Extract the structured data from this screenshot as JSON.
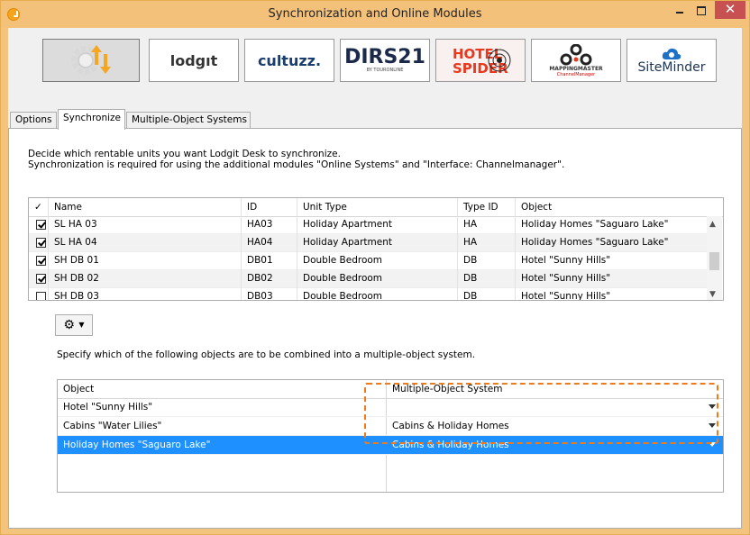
{
  "window": {
    "title": "Synchronization and Online Modules"
  },
  "modules": [
    {
      "name": "sync",
      "label": "⟲⇅"
    },
    {
      "name": "lodgit",
      "label": "lodgıt"
    },
    {
      "name": "cultuzz",
      "label": "cultuzz."
    },
    {
      "name": "dirs21",
      "label": "DIRS21",
      "sub": "BY TOURONLINE"
    },
    {
      "name": "hotelspider",
      "label": "HOTEL SPIDER"
    },
    {
      "name": "mappingmaster",
      "label": "MAPPINGMASTER",
      "sub": "ChannelManager"
    },
    {
      "name": "siteminder",
      "label": "SiteMinder"
    }
  ],
  "tabs": [
    "Options",
    "Synchronize",
    "Multiple-Object Systems"
  ],
  "description": {
    "line1": "Decide which rentable units you want Lodgit Desk to synchronize.",
    "line2": "Synchronization is required for using the additional modules \"Online Systems\" and \"Interface: Channelmanager\"."
  },
  "units_table": {
    "headers": {
      "check": "✓",
      "name": "Name",
      "id": "ID",
      "unit_type": "Unit Type",
      "type_id": "Type ID",
      "object": "Object"
    },
    "rows": [
      {
        "checked": true,
        "name": "SL HA 03",
        "id": "HA03",
        "unit_type": "Holiday Apartment",
        "type_id": "HA",
        "object": "Holiday Homes \"Saguaro Lake\""
      },
      {
        "checked": true,
        "name": "SL HA 04",
        "id": "HA04",
        "unit_type": "Holiday Apartment",
        "type_id": "HA",
        "object": "Holiday Homes \"Saguaro Lake\""
      },
      {
        "checked": true,
        "name": "SH DB 01",
        "id": "DB01",
        "unit_type": "Double Bedroom",
        "type_id": "DB",
        "object": "Hotel \"Sunny Hills\""
      },
      {
        "checked": true,
        "name": "SH DB 02",
        "id": "DB02",
        "unit_type": "Double Bedroom",
        "type_id": "DB",
        "object": "Hotel \"Sunny Hills\""
      },
      {
        "checked": false,
        "name": "SH DB 03",
        "id": "DB03",
        "unit_type": "Double Bedroom",
        "type_id": "DB",
        "object": "Hotel \"Sunny Hills\""
      }
    ]
  },
  "specify_text": "Specify which of the following objects are to be combined into a multiple-object system.",
  "objects_table": {
    "headers": {
      "object": "Object",
      "mos": "Multiple-Object System"
    },
    "rows": [
      {
        "object": "Hotel \"Sunny Hills\"",
        "mos": ""
      },
      {
        "object": "Cabins \"Water Lilies\"",
        "mos": "Cabins & Holiday Homes"
      },
      {
        "object": "Holiday Homes \"Saguaro Lake\"",
        "mos": "Cabins & Holiday Homes"
      }
    ]
  },
  "colors": {
    "title_bar": "#f3c17a",
    "close": "#c75050",
    "selection": "#1e90ff",
    "highlight": "#f07a1a"
  }
}
